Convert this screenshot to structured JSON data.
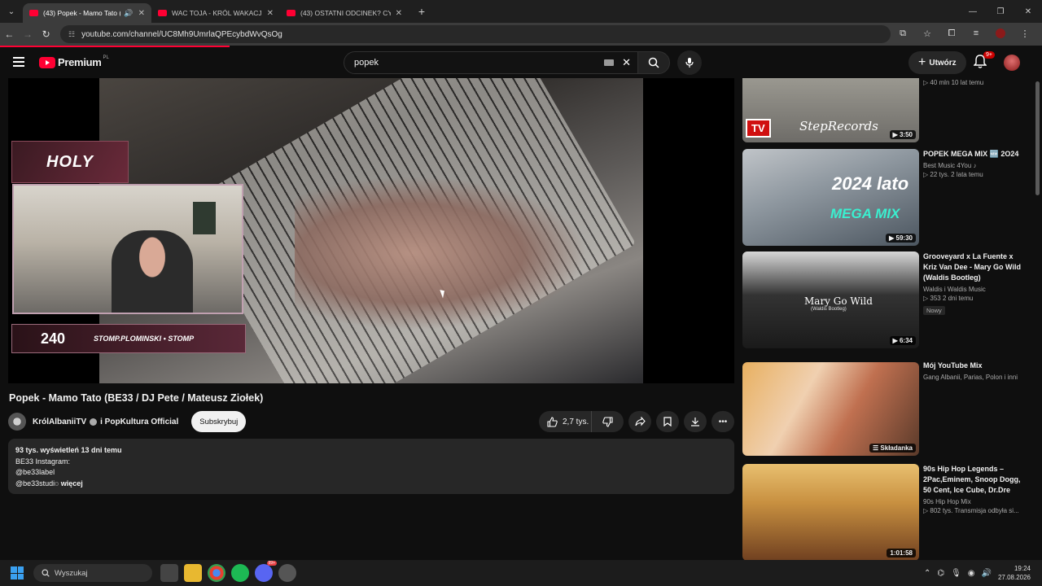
{
  "browser": {
    "tabs": [
      {
        "title": "(43) Popek - Mamo Tato (B",
        "active": true,
        "audio": true
      },
      {
        "title": "WAC TOJA - KRÓL WAKACJI (O",
        "active": false,
        "audio": false
      },
      {
        "title": "(43) OSTATNI ODCINEK? CYPE",
        "active": false,
        "audio": false
      }
    ],
    "url": "youtube.com/channel/UC8Mh9UmrlaQPEcybdWvQsOg",
    "new_tab": "+"
  },
  "youtube": {
    "logo_text": "Premium",
    "logo_region": "PL",
    "search_value": "popek",
    "create_label": "Utwórz",
    "notif_badge": "9+"
  },
  "player": {
    "overlay_top": "HOLY",
    "overlay_count": "240",
    "overlay_handle": "STOMP.PLOMINSKI  •  STOMP"
  },
  "video": {
    "title": "Popek - Mamo Tato (BE33 / DJ Pete / Mateusz Ziołek)",
    "channel": "KrólAlbaniiTV",
    "channel_with": "i PopKultura Official",
    "subscribe_label": "Subskrybuj",
    "likes": "2,7 tys.",
    "description": {
      "stats": "93 tys. wyświetleń  13 dni temu",
      "line1": "BE33 Instagram:",
      "line2": "@be33label",
      "line3": "@be33studi",
      "line3_fade": "o",
      "more": "więcej"
    }
  },
  "sidebar": [
    {
      "title": "",
      "channel": "",
      "meta": "40 mln  10 lat temu",
      "duration": "3:50",
      "thumb_text": "StepRecords",
      "thumb_badge": "TV"
    },
    {
      "title": "POPEK MEGA MIX 🆕 2O24",
      "channel": "Best Music 4You",
      "meta": "22 tys.  2 lata temu",
      "duration": "59:30",
      "thumb_text": "2024 lato",
      "thumb_sub": "MEGA MIX"
    },
    {
      "title": "Grooveyard  x La Fuente x Kriz Van Dee - Mary Go Wild (Waldis Bootleg)",
      "channel": "Waldis  i Waldis Music",
      "meta": "353  2 dni temu",
      "duration": "6:34",
      "badge": "Nowy",
      "thumb_text": "Mary Go Wild",
      "thumb_sub": "(Waldis Bootleg)"
    },
    {
      "title": "Mój YouTube Mix",
      "channel": "Gang Albanii, Parias, Polon i inni",
      "meta": "",
      "duration": "Składanka"
    },
    {
      "title": "90s Hip Hop Legends – 2Pac,Eminem, Snoop Dogg, 50 Cent, Ice Cube, Dr.Dre",
      "channel": "90s Hip Hop Mix",
      "meta": "802 tys.  Transmisja odbyła si...",
      "duration": "1:01:58"
    }
  ],
  "taskbar": {
    "search_placeholder": "Wyszukaj",
    "time": "19:24",
    "date": "27.08.2026",
    "discord_badge": "99+"
  },
  "colors": {
    "accent": "#ff0033",
    "background": "#0f0f0f",
    "panel": "#272727"
  }
}
